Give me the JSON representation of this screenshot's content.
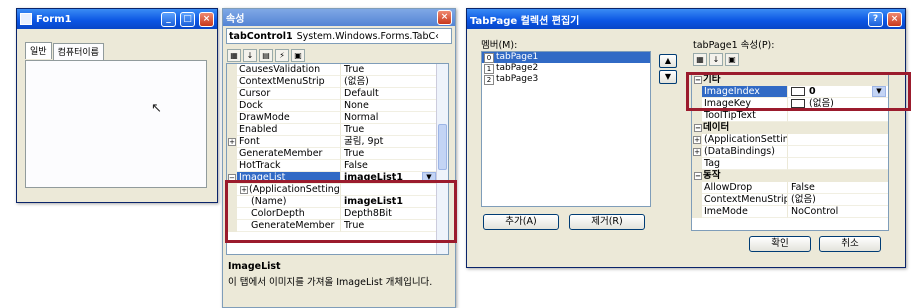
{
  "form1": {
    "title": "Form1",
    "tabs": [
      "일반",
      "컴퓨터이름"
    ]
  },
  "props": {
    "title": "속성",
    "object_name": "tabControl1",
    "object_type": "System.Windows.Forms.TabC‹",
    "rows": [
      {
        "name": "CausesValidation",
        "value": "True"
      },
      {
        "name": "ContextMenuStrip",
        "value": "(없음)"
      },
      {
        "name": "Cursor",
        "value": "Default"
      },
      {
        "name": "Dock",
        "value": "None"
      },
      {
        "name": "DrawMode",
        "value": "Normal"
      },
      {
        "name": "Enabled",
        "value": "True"
      },
      {
        "name": "Font",
        "value": "굴림, 9pt"
      },
      {
        "name": "GenerateMember",
        "value": "True"
      },
      {
        "name": "HotTrack",
        "value": "False"
      },
      {
        "name": "ImageList",
        "value": "imageList1"
      },
      {
        "name": "(ApplicationSetting",
        "value": ""
      },
      {
        "name": "(Name)",
        "value": "imageList1"
      },
      {
        "name": "ColorDepth",
        "value": "Depth8Bit"
      },
      {
        "name": "GenerateMember",
        "value": "True"
      }
    ],
    "desc_title": "ImageList",
    "desc_text": "이 탭에서 이미지를 가져올 ImageList 개체입니다."
  },
  "editor": {
    "title": "TabPage 컬렉션 편집기",
    "members_label": "멤버(M):",
    "members": [
      {
        "idx": "0",
        "name": "tabPage1"
      },
      {
        "idx": "1",
        "name": "tabPage2"
      },
      {
        "idx": "2",
        "name": "tabPage3"
      }
    ],
    "add_button": "추가(A)",
    "remove_button": "제거(R)",
    "props_label": "tabPage1 속성(P):",
    "cat_behavior": "기타",
    "image_index_name": "ImageIndex",
    "image_index_value": "0",
    "image_key_name": "ImageKey",
    "image_key_value": "(없음)",
    "tooltip_name": "ToolTipText",
    "cat_data": "데이터",
    "data_rows": [
      {
        "name": "(ApplicationSetting",
        "value": ""
      },
      {
        "name": "(DataBindings)",
        "value": ""
      },
      {
        "name": "Tag",
        "value": ""
      }
    ],
    "cat_action": "동작",
    "action_rows": [
      {
        "name": "AllowDrop",
        "value": "False"
      },
      {
        "name": "ContextMenuStrip",
        "value": "(없음)"
      },
      {
        "name": "ImeMode",
        "value": "NoControl"
      }
    ],
    "ok_button": "확인",
    "cancel_button": "취소"
  },
  "colors": {
    "highlight_box": "#9b1b2d",
    "selection": "#316ac5"
  }
}
